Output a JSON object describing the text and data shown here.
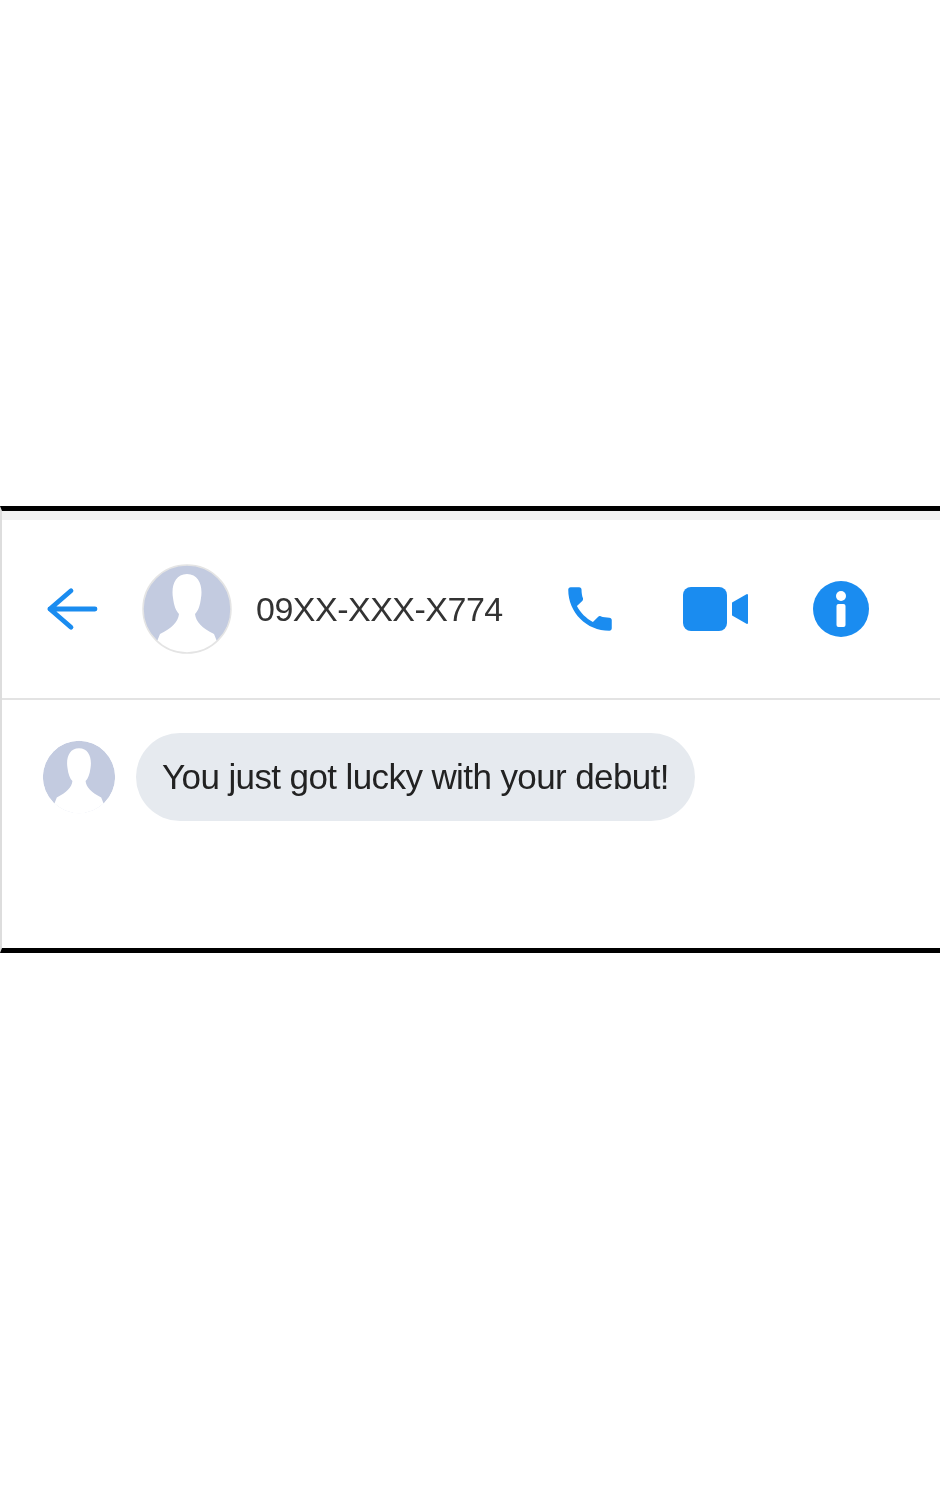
{
  "header": {
    "contact": "09XX-XXX-X774"
  },
  "messages": [
    {
      "text": "You just got lucky with your debut!"
    }
  ]
}
